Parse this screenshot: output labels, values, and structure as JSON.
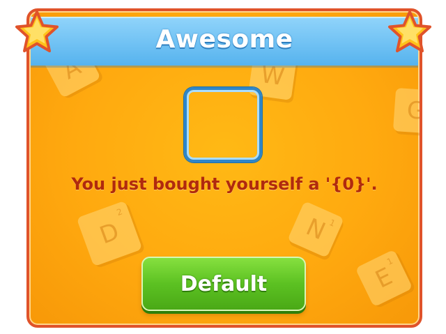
{
  "dialog": {
    "title": "Awesome",
    "message": "You just bought yourself a '{0}'.",
    "button_label": "Default"
  },
  "background_tiles": [
    {
      "letter": "A",
      "points": ""
    },
    {
      "letter": "W",
      "points": ""
    },
    {
      "letter": "D",
      "points": "2"
    },
    {
      "letter": "N",
      "points": "1"
    },
    {
      "letter": "E",
      "points": "1"
    },
    {
      "letter": "G",
      "points": ""
    }
  ],
  "colors": {
    "panel_orange": "#ffa90f",
    "border_red": "#e0532a",
    "header_blue": "#56b3ee",
    "message_red": "#b02a0e",
    "button_green": "#5cc122",
    "star_gold": "#ffc21a",
    "frame_blue": "#2e86c9"
  },
  "icons": {
    "left_star": "star-icon",
    "right_star": "star-icon"
  }
}
